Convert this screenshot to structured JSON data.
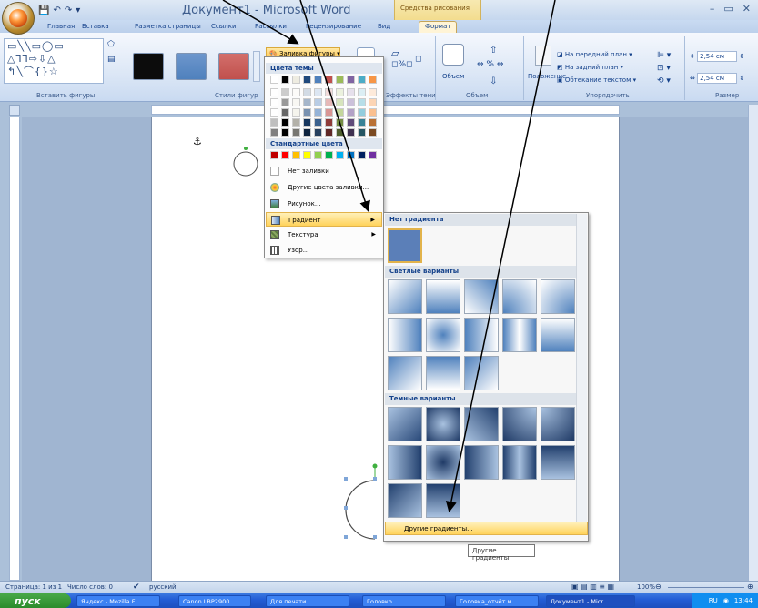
{
  "window": {
    "title": "Документ1 - Microsoft Word",
    "contextual_group": "Средства рисования",
    "controls": [
      "–",
      "▭",
      "✕"
    ]
  },
  "qat": {
    "icons": [
      "save-icon",
      "undo-icon",
      "redo-icon",
      "qat-menu-icon"
    ]
  },
  "tabs": [
    "Главная",
    "Вставка",
    "Разметка страницы",
    "Ссылки",
    "Рассылки",
    "Рецензирование",
    "Вид",
    "Формат"
  ],
  "active_tab": "Формат",
  "ribbon": {
    "groups": [
      "Вставить фигуры",
      "Стили фигур",
      "Эффекты тени",
      "Объем",
      "Упорядочить",
      "Размер"
    ],
    "shapes_gallery_rows": [
      "▭╲╲▭◯▭",
      "△⅂⅂⇨⇩△",
      "↰╲⌒{}☆"
    ],
    "shape_fill_label": "Заливка фигуры",
    "style_colors": [
      "#0c0c0c",
      "#4f81bd",
      "#c0504d"
    ],
    "shadow_label": "",
    "volume_label": "Объем",
    "position_label": "Положение",
    "bring_front": "На передний план",
    "send_back": "На задний план",
    "text_wrap": "Обтекание текстом",
    "height_value": "2,54 см",
    "width_value": "2,54 см"
  },
  "shape_fill_menu": {
    "theme_colors_header": "Цвета темы",
    "theme_colors": [
      "#ffffff",
      "#000000",
      "#eeece1",
      "#1f497d",
      "#4f81bd",
      "#c0504d",
      "#9bbb59",
      "#8064a2",
      "#4bacc6",
      "#f79646"
    ],
    "standard_colors_header": "Стандартные цвета",
    "standard_colors": [
      "#c00000",
      "#ff0000",
      "#ffc000",
      "#ffff00",
      "#92d050",
      "#00b050",
      "#00b0f0",
      "#0070c0",
      "#002060",
      "#7030a0"
    ],
    "items": [
      {
        "label": "Нет заливки",
        "icon": "no-fill-icon"
      },
      {
        "label": "Другие цвета заливки...",
        "icon": "color-palette-icon"
      },
      {
        "label": "Рисунок...",
        "icon": "picture-icon"
      },
      {
        "label": "Градиент",
        "icon": "gradient-icon"
      },
      {
        "label": "Текстура",
        "icon": "texture-icon"
      },
      {
        "label": "Узор...",
        "icon": "pattern-icon"
      }
    ],
    "highlighted": "Градиент"
  },
  "gradient_submenu": {
    "no_gradient_header": "Нет градиента",
    "light_header": "Светлые варианты",
    "dark_header": "Темные варианты",
    "more_label": "Другие градиенты...",
    "tooltip": "Другие градиенты"
  },
  "status": {
    "page": "Страница: 1 из 1",
    "words": "Число слов: 0",
    "language": "русский",
    "zoom": "100%"
  },
  "taskbar": {
    "start": "пуск",
    "tasks": [
      "Яндекс - Mozilla F...",
      "Canon LBP2900",
      "Для печати",
      "Головко",
      "Головка_отчёт м...",
      "Документ1 - Micr..."
    ],
    "lang": "RU",
    "time": "13:44"
  }
}
